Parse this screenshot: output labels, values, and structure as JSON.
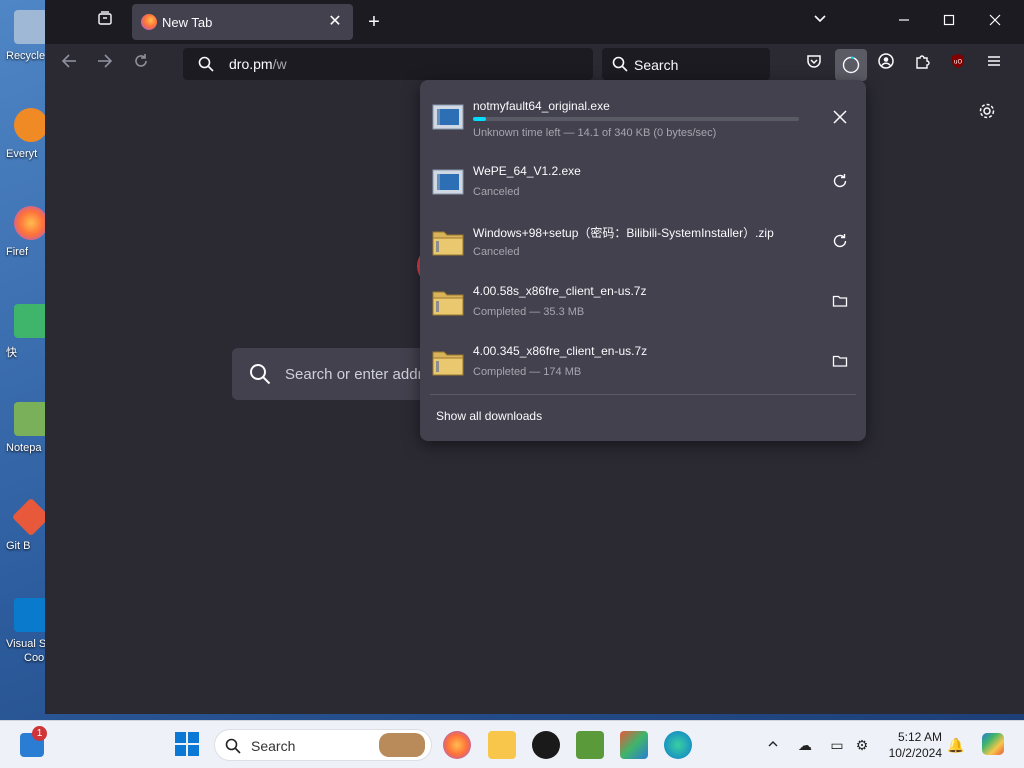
{
  "desktop": {
    "icons": [
      {
        "label": "Recycle",
        "color": "#9fb8d6"
      },
      {
        "label": "Everyt",
        "color": "#f08a24"
      },
      {
        "label": "Firef",
        "color": "#ff7139"
      },
      {
        "label": "快",
        "color": "#3fb56b"
      },
      {
        "label": "Notepa",
        "color": "#7ab05a"
      },
      {
        "label": "Git B",
        "color": "#e8583a"
      },
      {
        "label": "Visual S",
        "color": "#0a7acc"
      }
    ],
    "last_icon_line2": "Coo"
  },
  "browser": {
    "tab": {
      "title": "New Tab"
    },
    "url": {
      "host": "dro.pm",
      "path": "/w"
    },
    "search_placeholder": "Search",
    "newtab_search_placeholder": "Search or enter addr"
  },
  "downloads": {
    "items": [
      {
        "name": "notmyfault64_original.exe",
        "status": "Unknown time left — 14.1 of 340 KB (0 bytes/sec)",
        "action_icon": "close-icon",
        "kind": "exe",
        "progress": 0.04
      },
      {
        "name": "WePE_64_V1.2.exe",
        "status": "Canceled",
        "action_icon": "retry-icon",
        "kind": "exe"
      },
      {
        "name": "Windows+98+setup（密码：Bilibili-SystemInstaller）.zip",
        "status": "Canceled",
        "action_icon": "retry-icon",
        "kind": "archive"
      },
      {
        "name": "4.00.58s_x86fre_client_en-us.7z",
        "status": "Completed — 35.3 MB",
        "action_icon": "folder-icon",
        "kind": "archive"
      },
      {
        "name": "4.00.345_x86fre_client_en-us.7z",
        "status": "Completed — 174 MB",
        "action_icon": "folder-icon",
        "kind": "archive"
      }
    ],
    "show_all": "Show all downloads"
  },
  "taskbar": {
    "search_placeholder": "Search",
    "widget_badge": "1",
    "time": "5:12 AM",
    "date": "10/2/2024"
  },
  "colors": {
    "accent": "#00ddff",
    "panel": "#42414d",
    "toolbar": "#2b2a33"
  }
}
